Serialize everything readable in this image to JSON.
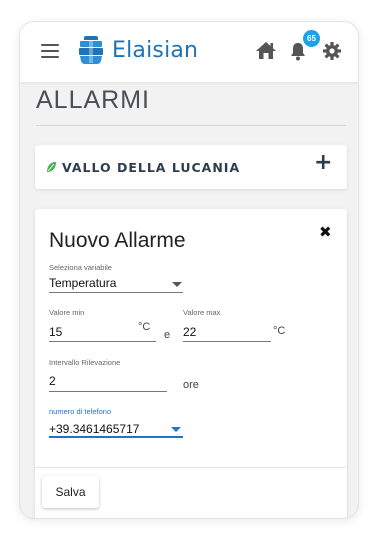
{
  "header": {
    "app_name": "Elaisian",
    "notification_count": "65",
    "icons": [
      "hamburger-menu-icon",
      "home-icon",
      "bell-icon",
      "gear-icon"
    ],
    "brand_color": "#1e73b7",
    "badge_color": "#1ea2e6"
  },
  "page": {
    "title": "ALLARMI"
  },
  "site": {
    "name": "VALLO DELLA LUCANIA",
    "leaf_color": "#4caf50",
    "add_symbol": "+"
  },
  "form": {
    "title": "Nuovo Allarme",
    "close_symbol": "✖",
    "variable": {
      "label": "Seleziona variabile",
      "value": "Temperatura"
    },
    "min": {
      "label": "Valore min",
      "value": "15",
      "unit": "°C"
    },
    "joiner": "e",
    "max": {
      "label": "Valore max",
      "value": "22",
      "unit": "°C"
    },
    "interval": {
      "label": "Intervallo Rilevazione",
      "value": "2",
      "unit": "ore"
    },
    "phone": {
      "label": "numero di telefono",
      "value": "+39.3461465717",
      "accent_color": "#1e73d0"
    },
    "save_label": "Salva"
  }
}
